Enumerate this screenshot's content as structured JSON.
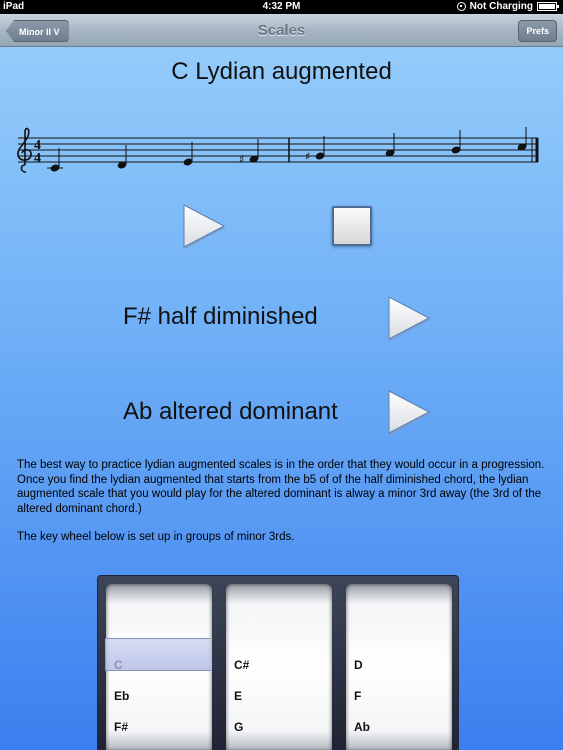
{
  "status_bar": {
    "carrier": "iPad",
    "time": "4:32 PM",
    "charging": "Not Charging"
  },
  "nav": {
    "title": "Scales",
    "back_label": "Minor II V",
    "prefs_label": "Prefs"
  },
  "scale": {
    "title": "C Lydian augmented",
    "time_signature": [
      "4",
      "4"
    ],
    "notes": [
      "C",
      "D",
      "E",
      "F#",
      "G#",
      "A",
      "B",
      "C"
    ]
  },
  "chords": [
    {
      "label": "F# half diminished"
    },
    {
      "label": "Ab altered dominant"
    }
  ],
  "description": {
    "paragraph1": "The best way to practice lydian augmented scales is in the order that they would occur in a progression.  Once you find the lydian augmented that starts from the b5 of of the half diminished chord, the lydian augmented scale that you would play for the altered dominant is alway a minor 3rd away (the 3rd of the altered dominant chord.)",
    "paragraph2": "The key wheel below is set up in groups of minor 3rds."
  },
  "picker": {
    "wheels": [
      {
        "items": [
          "C",
          "Eb",
          "F#"
        ],
        "selected": "C"
      },
      {
        "items": [
          "C#",
          "E",
          "G"
        ]
      },
      {
        "items": [
          "D",
          "F",
          "Ab"
        ]
      }
    ]
  },
  "icons": {
    "play": "play-icon",
    "stop": "stop-icon",
    "treble_clef": "treble-clef-icon"
  }
}
